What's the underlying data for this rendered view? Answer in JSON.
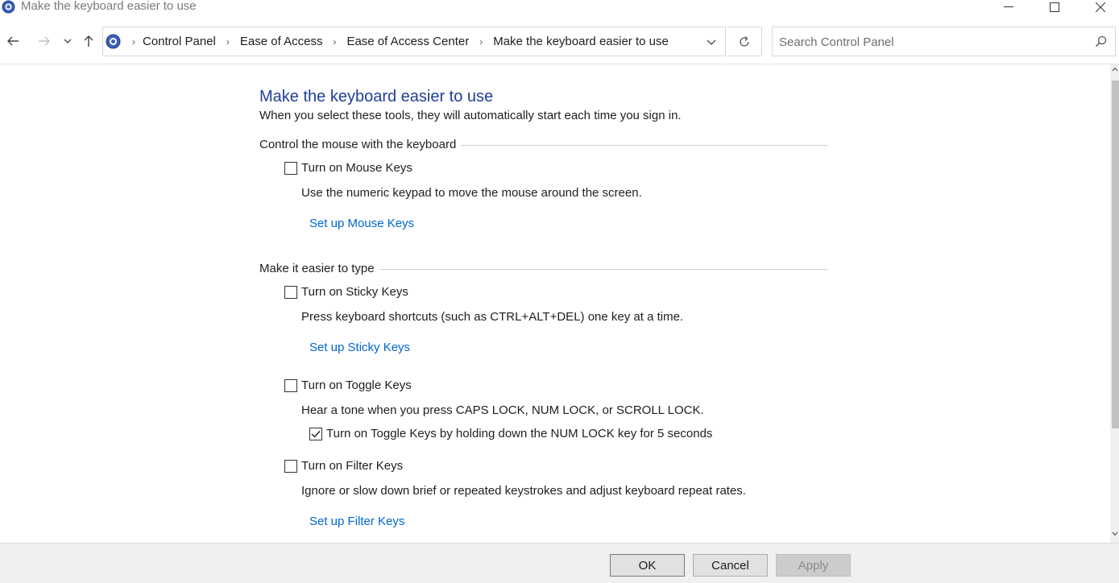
{
  "window": {
    "title": "Make the keyboard easier to use",
    "app_icon": "control-panel-icon",
    "controls": [
      "minimize-icon",
      "maximize-icon",
      "close-icon"
    ]
  },
  "nav": {
    "back_icon": "arrow-left-icon",
    "forward_icon": "arrow-right-icon",
    "recent_icon": "chevron-down-icon",
    "up_icon": "arrow-up-icon",
    "breadcrumbs": [
      "Control Panel",
      "Ease of Access",
      "Ease of Access Center",
      "Make the keyboard easier to use"
    ],
    "refresh_icon": "refresh-icon",
    "search_placeholder": "Search Control Panel",
    "search_icon": "search-icon"
  },
  "main": {
    "title": "Make the keyboard easier to use",
    "description": "When you select these tools, they will automatically start each time you sign in.",
    "sections": [
      {
        "header": "Control the mouse with the keyboard",
        "mouse_keys": {
          "label": "Turn on Mouse Keys",
          "checked": false,
          "description": "Use the numeric keypad to move the mouse around the screen.",
          "link": "Set up Mouse Keys"
        }
      },
      {
        "header": "Make it easier to type",
        "sticky_keys": {
          "label": "Turn on Sticky Keys",
          "checked": false,
          "description": "Press keyboard shortcuts (such as CTRL+ALT+DEL) one key at a time.",
          "link": "Set up Sticky Keys"
        },
        "toggle_keys": {
          "label": "Turn on Toggle Keys",
          "checked": false,
          "description": "Hear a tone when you press CAPS LOCK, NUM LOCK, or SCROLL LOCK.",
          "sub_option": {
            "label": "Turn on Toggle Keys by holding down the NUM LOCK key for 5 seconds",
            "checked": true
          }
        },
        "filter_keys": {
          "label": "Turn on Filter Keys",
          "checked": false,
          "description": "Ignore or slow down brief or repeated keystrokes and adjust keyboard repeat rates.",
          "link": "Set up Filter Keys"
        }
      }
    ]
  },
  "buttons": {
    "ok": "OK",
    "cancel": "Cancel",
    "apply": "Apply",
    "apply_enabled": false
  },
  "colors": {
    "title": "#1f3f99",
    "link": "#0066cc",
    "footer_bg": "#f0f0f0"
  }
}
